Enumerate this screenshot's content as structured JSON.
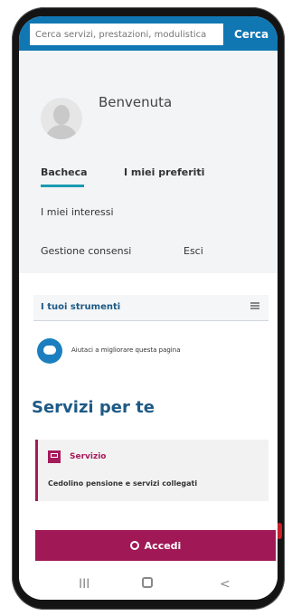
{
  "search": {
    "placeholder": "Cerca servizi, prestazioni, modulistica",
    "button_label": "Cerca"
  },
  "profile": {
    "welcome": "Benvenuta"
  },
  "tabs": {
    "bacheca": "Bacheca",
    "preferiti": "I miei preferiti",
    "interessi": "I miei interessi",
    "consensi": "Gestione consensi",
    "esci": "Esci"
  },
  "tools": {
    "label": "I tuoi strumenti"
  },
  "feedback": {
    "text": "Aiutaci a migliorare questa pagina"
  },
  "services": {
    "title": "Servizi per te",
    "card_label": "Servizio",
    "card_title": "Cedolino pensione e servizi collegati"
  },
  "login": {
    "button_label": "Accedi"
  },
  "nav": {
    "recent": "III",
    "back": "<"
  },
  "colors": {
    "primary_blue": "#1177b3",
    "accent_magenta": "#a01855"
  }
}
